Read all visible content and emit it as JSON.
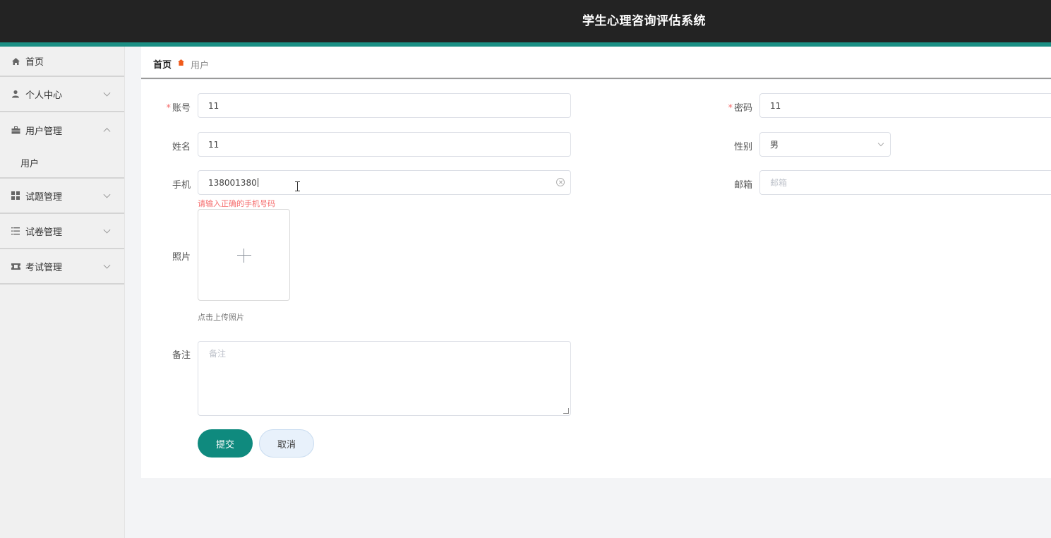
{
  "app": {
    "title": "学生心理咨询评估系统"
  },
  "sidebar": {
    "items": [
      {
        "label": "首页",
        "icon": "home-icon"
      },
      {
        "label": "个人中心",
        "icon": "user-icon"
      },
      {
        "label": "用户管理",
        "icon": "briefcase-icon",
        "expanded": true,
        "children": [
          {
            "label": "用户"
          }
        ]
      },
      {
        "label": "试题管理",
        "icon": "grid-icon"
      },
      {
        "label": "试卷管理",
        "icon": "list-icon"
      },
      {
        "label": "考试管理",
        "icon": "ticket-icon"
      }
    ]
  },
  "breadcrumb": {
    "home": "首页",
    "current": "用户"
  },
  "form": {
    "account": {
      "label": "账号",
      "value": "11",
      "required": true
    },
    "password": {
      "label": "密码",
      "value": "11",
      "required": true
    },
    "name": {
      "label": "姓名",
      "value": "11"
    },
    "gender": {
      "label": "性别",
      "value": "男"
    },
    "phone": {
      "label": "手机",
      "value": "138001380",
      "error": "请输入正确的手机号码"
    },
    "email": {
      "label": "邮箱",
      "placeholder": "邮箱"
    },
    "photo": {
      "label": "照片",
      "tip": "点击上传照片"
    },
    "note": {
      "label": "备注",
      "placeholder": "备注"
    },
    "submit_label": "提交",
    "cancel_label": "取消"
  },
  "colors": {
    "accent": "#0f8a7e",
    "header": "#232323",
    "error": "#f56c6c"
  }
}
